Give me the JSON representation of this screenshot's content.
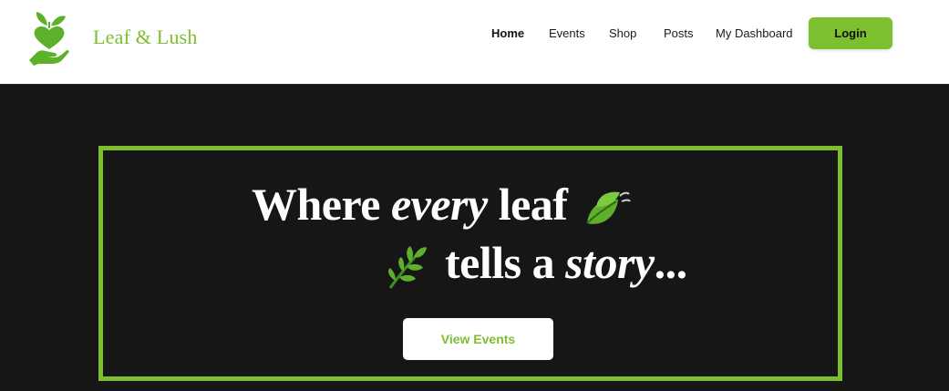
{
  "brand": {
    "name": "Leaf & Lush",
    "logo_icon": "heart-leaf-hand-icon",
    "color": "#7cbf2f"
  },
  "nav": {
    "items": [
      {
        "label": "Home",
        "active": true
      },
      {
        "label": "Events",
        "active": false
      },
      {
        "label": "Shop",
        "active": false
      },
      {
        "label": "Posts",
        "active": false
      },
      {
        "label": "My Dashboard",
        "active": false
      }
    ],
    "login_label": "Login"
  },
  "hero": {
    "line1_start": "Where ",
    "line1_emphasis": "every",
    "line1_end": " leaf",
    "line1_icon": "leaf-fluttering-icon",
    "line2_icon": "herb-sprig-icon",
    "line2_start": "tells a ",
    "line2_emphasis": "story",
    "line2_end": "...",
    "cta_label": "View Events"
  },
  "colors": {
    "accent": "#7cbf2f",
    "background_dark": "#161616",
    "navbar_bg": "#ffffff"
  }
}
